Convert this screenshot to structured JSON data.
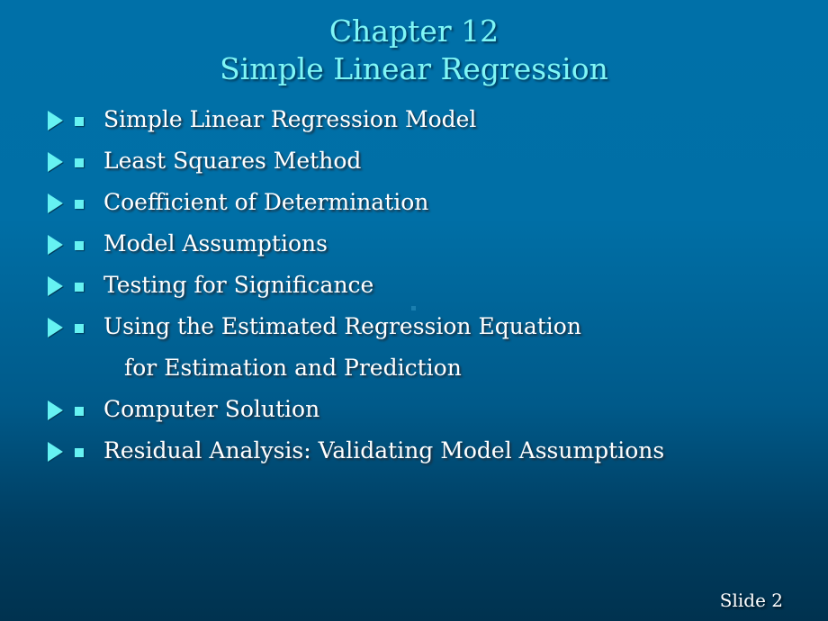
{
  "slide": {
    "title_line1": "Chapter 12",
    "title_line2": "Simple Linear Regression",
    "items": [
      {
        "label": "Simple Linear Regression Model"
      },
      {
        "label": "Least Squares Method"
      },
      {
        "label": "Coefficient of Determination"
      },
      {
        "label": "Model Assumptions"
      },
      {
        "label": "Testing for Significance"
      },
      {
        "label": "Using the Estimated Regression Equation",
        "continuation": "for Estimation and Prediction"
      },
      {
        "label": "Computer Solution"
      },
      {
        "label": "Residual Analysis: Validating Model Assumptions"
      }
    ],
    "footer": "Slide 2"
  },
  "colors": {
    "title": "#7ff6f6",
    "bullet": "#66f2f2",
    "text": "#ffffff",
    "background_top": "#0070a8",
    "background_bottom": "#00324f"
  }
}
